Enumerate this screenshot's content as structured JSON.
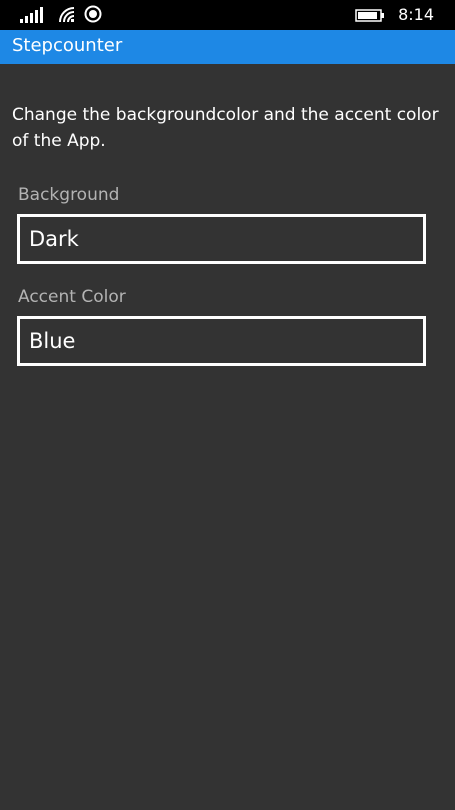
{
  "status_bar": {
    "time": "8:14",
    "icons": [
      "signal-icon",
      "wifi-icon",
      "location-icon",
      "battery-icon"
    ]
  },
  "app": {
    "title": "Stepcounter"
  },
  "settings": {
    "description": "Change the backgroundcolor and the accent color of the App.",
    "background": {
      "label": "Background",
      "value": "Dark"
    },
    "accent": {
      "label": "Accent Color",
      "value": "Blue"
    }
  },
  "colors": {
    "accent": "#1e88e5",
    "page_background": "#333333",
    "status_bar": "#000000",
    "label_text": "#b3b3b3"
  }
}
